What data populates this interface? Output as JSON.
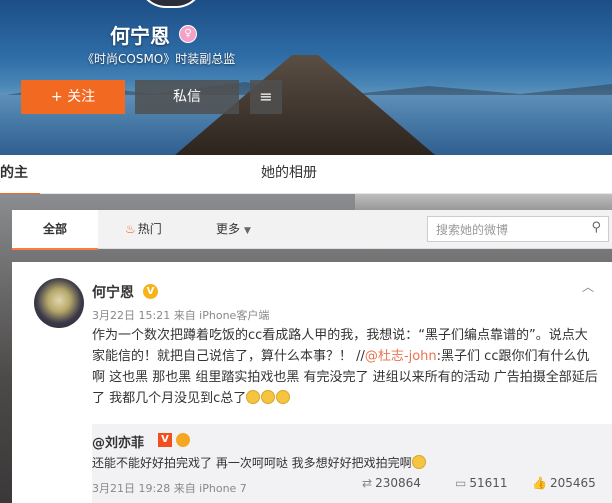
{
  "profile": {
    "name": "何宁恩",
    "title": "《时尚COSMO》时装副总监",
    "follow_label": "关注",
    "follow_plus": "+",
    "message_label": "私信",
    "menu_icon": "≡"
  },
  "profile_tabs": {
    "home": "的主页",
    "album": "她的相册"
  },
  "feed_filter": {
    "all": "全部",
    "hot": "热门",
    "more": "更多",
    "search_placeholder": "搜索她的微博"
  },
  "post": {
    "author": "何宁恩",
    "meta": "3月22日 15:21 来自 iPhone客户端",
    "text_a": "作为一个数次把蹲着吃饭的cc看成路人甲的我，我想说：“黑子们编点靠谱的”。说点大家能信的！就把自己说信了，算什么本事？！ //",
    "mention": "@杜志-john",
    "text_b": ":黑子们 cc跟你们有什么仇啊 这也黑 那也黑 组里踏实拍戏也黑 有完没完了 进组以来所有的活动 广告拍摄全部延后了 我都几个月没见到c总了",
    "repost": {
      "author": "@刘亦菲",
      "vip_mark": "V",
      "text": "还能不能好好拍完戏了 再一次呵呵哒 我多想好好把戏拍完啊",
      "meta": "3月21日 19:28 来自 iPhone 7",
      "reposts": "230864",
      "comments": "51611",
      "likes": "205465"
    }
  },
  "icons": {
    "verify": "pink-verify-icon",
    "vip": "orange-v-icon",
    "search": "search-icon",
    "fire": "fire-icon",
    "repost": "repost-icon",
    "comment": "comment-icon",
    "like": "like-icon"
  }
}
